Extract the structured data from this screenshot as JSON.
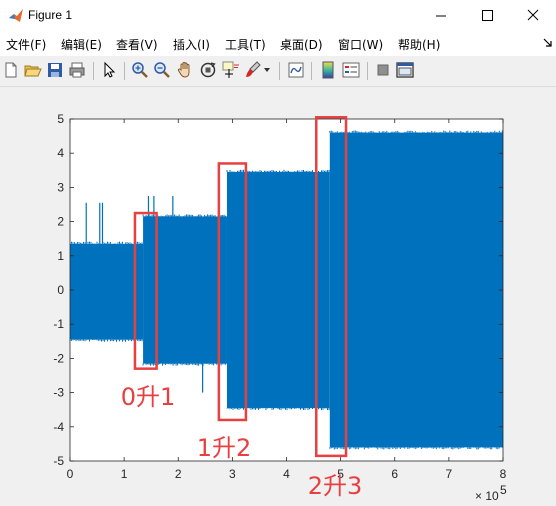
{
  "window": {
    "title": "Figure 1",
    "controls": [
      "minimize",
      "maximize",
      "close"
    ]
  },
  "menu": {
    "items": [
      "文件(F)",
      "编辑(E)",
      "查看(V)",
      "插入(I)",
      "工具(T)",
      "桌面(D)",
      "窗口(W)",
      "帮助(H)"
    ]
  },
  "toolbar": {
    "icons": [
      "new-figure-icon",
      "open-file-icon",
      "save-icon",
      "print-icon",
      "pointer-icon",
      "zoom-in-icon",
      "zoom-out-icon",
      "pan-hand-icon",
      "rotate-3d-icon",
      "data-cursor-icon",
      "brush-icon",
      "link-plot-icon",
      "colorbar-icon",
      "legend-icon",
      "hide-plot-tools-icon",
      "show-plot-tools-icon"
    ]
  },
  "chart_data": {
    "type": "line",
    "title": "",
    "xlabel": "",
    "ylabel": "",
    "x_exponent_label": "× 10",
    "x_exponent_power": "5",
    "xlim": [
      0,
      8
    ],
    "ylim": [
      -5,
      5
    ],
    "xticks": [
      "0",
      "1",
      "2",
      "3",
      "4",
      "5",
      "6",
      "7",
      "8"
    ],
    "yticks": [
      "5",
      "4",
      "3",
      "2",
      "1",
      "0",
      "-1",
      "-2",
      "-3",
      "-4",
      "-5"
    ],
    "series_color": "#0072bd",
    "envelope": [
      {
        "x_start": 0.0,
        "x_end": 1.35,
        "y_max": 1.35,
        "y_min": -1.45
      },
      {
        "x_start": 1.35,
        "x_end": 2.9,
        "y_max": 2.15,
        "y_min": -2.15
      },
      {
        "x_start": 2.9,
        "x_end": 4.8,
        "y_max": 3.45,
        "y_min": -3.45
      },
      {
        "x_start": 4.8,
        "x_end": 8.0,
        "y_max": 4.6,
        "y_min": -4.6
      }
    ],
    "spikes": [
      {
        "x": 0.3,
        "y": 2.55
      },
      {
        "x": 0.55,
        "y": 2.55
      },
      {
        "x": 0.6,
        "y": 2.55
      },
      {
        "x": 1.45,
        "y": 2.75
      },
      {
        "x": 1.55,
        "y": 2.75
      },
      {
        "x": 1.9,
        "y": 2.75
      },
      {
        "x": 2.45,
        "y": -3.0
      }
    ],
    "annotation_color": "#e84040",
    "annotations": [
      {
        "label": "0升1",
        "x_min": 1.2,
        "x_max": 1.6,
        "y_min": -2.3,
        "y_max": 2.25
      },
      {
        "label": "1升2",
        "x_min": 2.75,
        "x_max": 3.25,
        "y_min": -3.8,
        "y_max": 3.7
      },
      {
        "label": "2升3",
        "x_min": 4.55,
        "x_max": 5.1,
        "y_min": -4.85,
        "y_max": 5.05
      }
    ]
  }
}
